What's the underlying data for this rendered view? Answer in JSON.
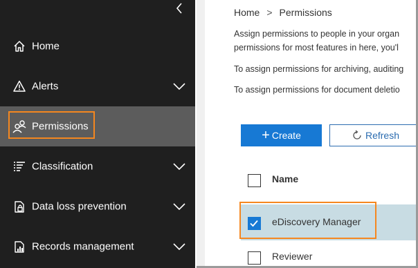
{
  "sidebar": {
    "items": [
      {
        "label": "Home",
        "icon": "home-icon"
      },
      {
        "label": "Alerts",
        "icon": "warning-icon"
      },
      {
        "label": "Permissions",
        "icon": "people-icon"
      },
      {
        "label": "Classification",
        "icon": "list-icon"
      },
      {
        "label": "Data loss prevention",
        "icon": "lock-icon"
      },
      {
        "label": "Records management",
        "icon": "chart-icon"
      }
    ],
    "active_item": "Permissions"
  },
  "breadcrumb": {
    "root": "Home",
    "separator": ">",
    "current": "Permissions"
  },
  "description": {
    "line1": "Assign permissions to people in your organ",
    "line2": "permissions for most features in here, you'l",
    "line3": "To assign permissions for archiving, auditing",
    "line4": "To assign permissions for document deletio"
  },
  "toolbar": {
    "create_label": "Create",
    "refresh_label": "Refresh"
  },
  "table": {
    "column_header": "Name",
    "rows": [
      {
        "name": "eDiscovery Manager",
        "checked": true
      },
      {
        "name": "Reviewer",
        "checked": false
      }
    ]
  },
  "colors": {
    "sidebar_bg": "#1f1f1f",
    "active_bg": "#5c5c5c",
    "accent": "#1779d4",
    "highlight": "#f5871f",
    "selected_row": "#c8dce3"
  }
}
